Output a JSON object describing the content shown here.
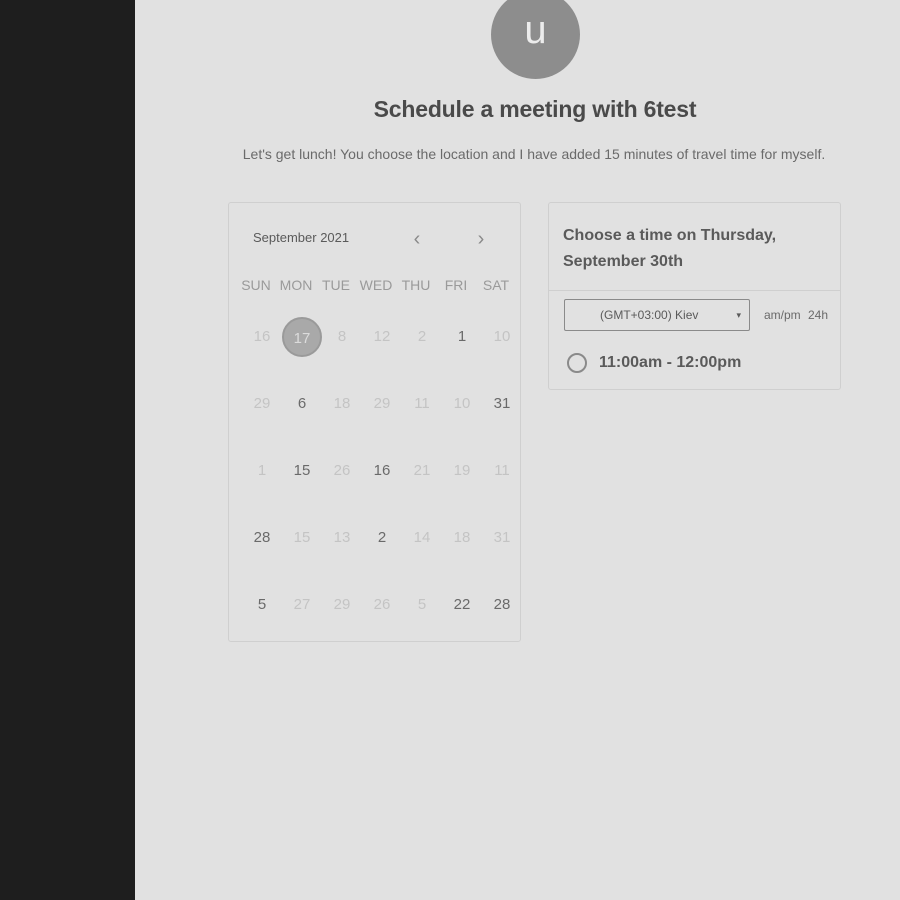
{
  "avatar": {
    "initial": "u"
  },
  "header": {
    "title": "Schedule a meeting with 6test",
    "subtitle": "Let's get lunch! You choose the location and I have added 15 minutes of travel time for myself."
  },
  "calendar": {
    "month_label": "September 2021",
    "prev_icon": "‹",
    "next_icon": "›",
    "weekdays": [
      "SUN",
      "MON",
      "TUE",
      "WED",
      "THU",
      "FRI",
      "SAT"
    ],
    "weeks": [
      [
        {
          "label": "16",
          "state": "disabled"
        },
        {
          "label": "17",
          "state": "selected"
        },
        {
          "label": "8",
          "state": "disabled"
        },
        {
          "label": "12",
          "state": "disabled"
        },
        {
          "label": "2",
          "state": "disabled"
        },
        {
          "label": "1",
          "state": "available"
        },
        {
          "label": "10",
          "state": "disabled"
        }
      ],
      [
        {
          "label": "29",
          "state": "disabled"
        },
        {
          "label": "6",
          "state": "available"
        },
        {
          "label": "18",
          "state": "disabled"
        },
        {
          "label": "29",
          "state": "disabled"
        },
        {
          "label": "11",
          "state": "disabled"
        },
        {
          "label": "10",
          "state": "disabled"
        },
        {
          "label": "31",
          "state": "available"
        }
      ],
      [
        {
          "label": "1",
          "state": "disabled"
        },
        {
          "label": "15",
          "state": "available"
        },
        {
          "label": "26",
          "state": "disabled"
        },
        {
          "label": "16",
          "state": "available"
        },
        {
          "label": "21",
          "state": "disabled"
        },
        {
          "label": "19",
          "state": "disabled"
        },
        {
          "label": "11",
          "state": "disabled"
        }
      ],
      [
        {
          "label": "28",
          "state": "available"
        },
        {
          "label": "15",
          "state": "disabled"
        },
        {
          "label": "13",
          "state": "disabled"
        },
        {
          "label": "2",
          "state": "available"
        },
        {
          "label": "14",
          "state": "disabled"
        },
        {
          "label": "18",
          "state": "disabled"
        },
        {
          "label": "31",
          "state": "disabled"
        }
      ],
      [
        {
          "label": "5",
          "state": "available"
        },
        {
          "label": "27",
          "state": "disabled"
        },
        {
          "label": "29",
          "state": "disabled"
        },
        {
          "label": "26",
          "state": "disabled"
        },
        {
          "label": "5",
          "state": "disabled"
        },
        {
          "label": "22",
          "state": "available"
        },
        {
          "label": "28",
          "state": "available"
        }
      ]
    ]
  },
  "time_picker": {
    "heading": "Choose a time on Thursday, September 30th",
    "timezone": "(GMT+03:00) Kiev",
    "timezone_caret": "▾",
    "format_12h": "am/pm",
    "format_24h": "24h",
    "slots": [
      {
        "label": "11:00am - 12:00pm"
      }
    ]
  }
}
